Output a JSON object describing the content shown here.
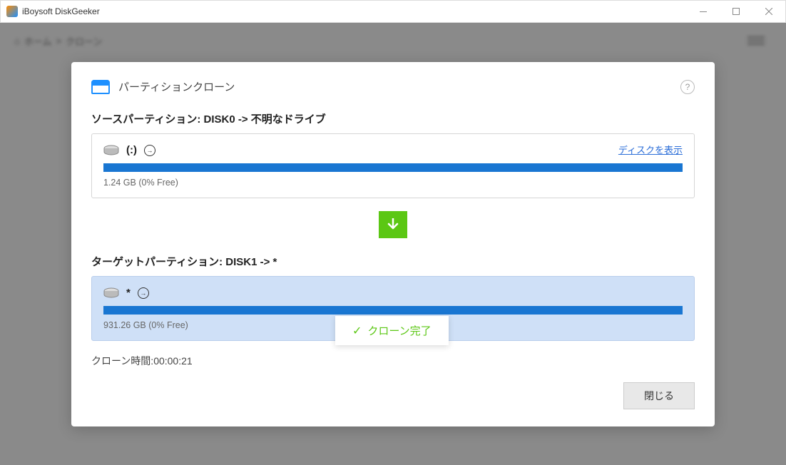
{
  "titlebar": {
    "app_name": "iBoysoft DiskGeeker"
  },
  "breadcrumb": {
    "home_label": "ホーム",
    "separator": ">",
    "current": "クローン"
  },
  "modal": {
    "title": "パーティションクローン",
    "help_char": "?",
    "source": {
      "label": "ソースパーティション: DISK0 -> 不明なドライブ",
      "show_disk_link": "ディスクを表示",
      "partition_label": "(:)",
      "size_text": "1.24 GB (0% Free)"
    },
    "target": {
      "label": "ターゲットパーティション: DISK1 -> *",
      "partition_label": "*",
      "size_text": "931.26 GB (0% Free)"
    },
    "status_toast": "クローン完了",
    "clone_time_label": "クローン時間:00:00:21",
    "close_button": "閉じる"
  }
}
